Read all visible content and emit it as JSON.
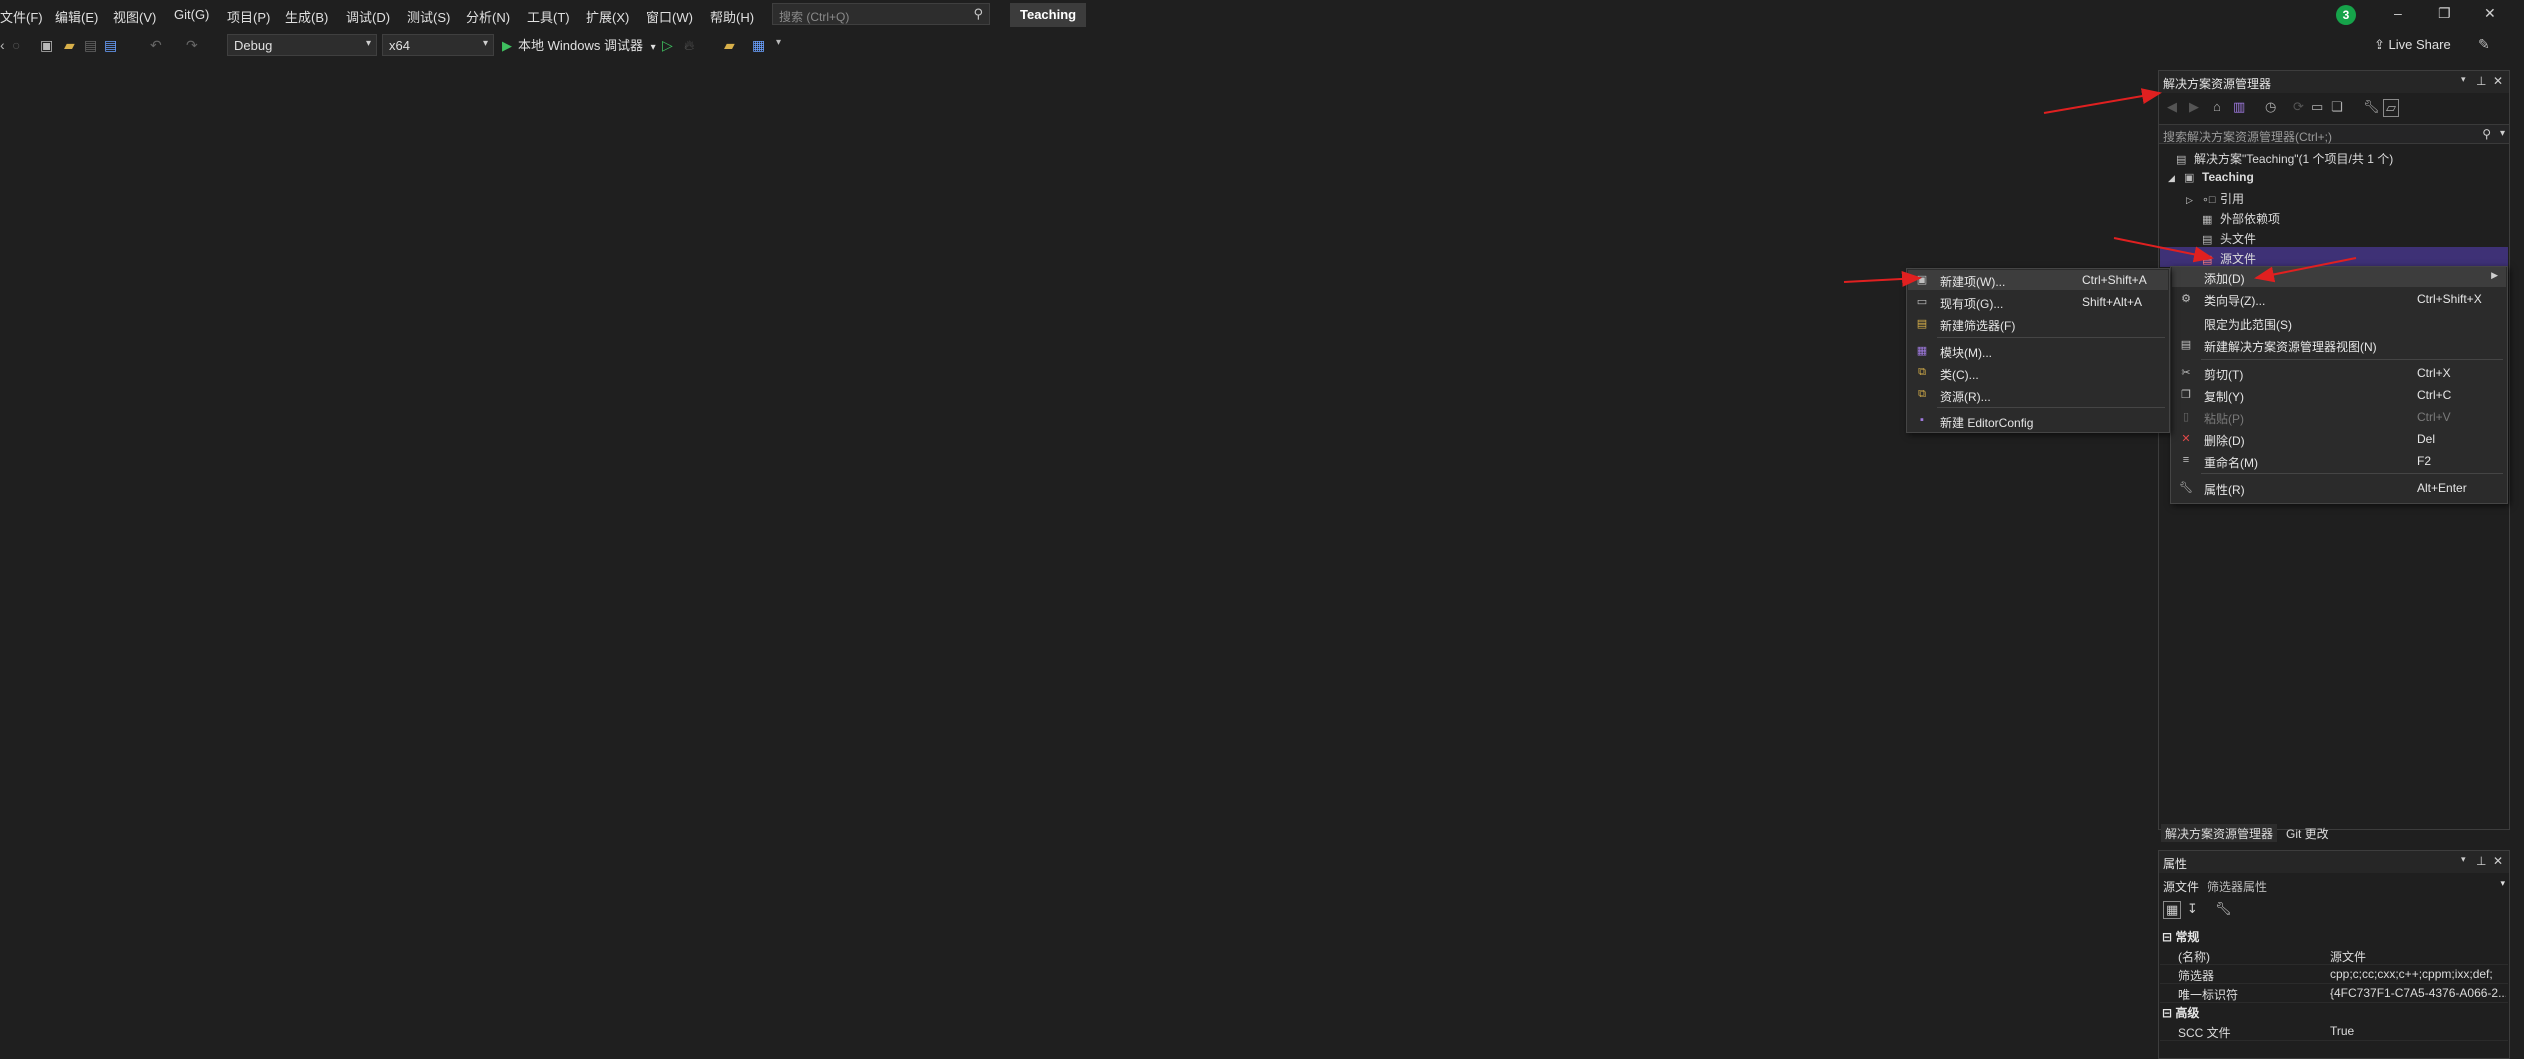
{
  "menu": {
    "items": [
      "文件(F)",
      "编辑(E)",
      "视图(V)",
      "Git(G)",
      "项目(P)",
      "生成(B)",
      "调试(D)",
      "测试(S)",
      "分析(N)",
      "工具(T)",
      "扩展(X)",
      "窗口(W)",
      "帮助(H)"
    ],
    "search_placeholder": "搜索 (Ctrl+Q)",
    "solution_name": "Teaching",
    "notification_count": "3"
  },
  "toolbar": {
    "configuration": "Debug",
    "platform": "x64",
    "run_label": "本地 Windows 调试器",
    "live_share": "Live Share"
  },
  "solution_explorer": {
    "title": "解决方案资源管理器",
    "search_placeholder": "搜索解决方案资源管理器(Ctrl+;)",
    "solution_row": "解决方案\"Teaching\"(1 个项目/共 1 个)",
    "project": "Teaching",
    "nodes": [
      "引用",
      "外部依赖项",
      "头文件",
      "源文件"
    ],
    "bottom_tabs": [
      "解决方案资源管理器",
      "Git 更改"
    ]
  },
  "context_menu": {
    "items": [
      {
        "label": "添加(D)",
        "shortcut": "",
        "submenu": true
      },
      {
        "label": "类向导(Z)...",
        "shortcut": "Ctrl+Shift+X"
      },
      {
        "label": "限定为此范围(S)",
        "shortcut": ""
      },
      {
        "label": "新建解决方案资源管理器视图(N)",
        "shortcut": ""
      },
      {
        "label": "剪切(T)",
        "shortcut": "Ctrl+X"
      },
      {
        "label": "复制(Y)",
        "shortcut": "Ctrl+C"
      },
      {
        "label": "粘贴(P)",
        "shortcut": "Ctrl+V",
        "disabled": true
      },
      {
        "label": "删除(D)",
        "shortcut": "Del"
      },
      {
        "label": "重命名(M)",
        "shortcut": "F2"
      },
      {
        "label": "属性(R)",
        "shortcut": "Alt+Enter"
      }
    ]
  },
  "add_submenu": {
    "items": [
      {
        "label": "新建项(W)...",
        "shortcut": "Ctrl+Shift+A"
      },
      {
        "label": "现有项(G)...",
        "shortcut": "Shift+Alt+A"
      },
      {
        "label": "新建筛选器(F)",
        "shortcut": ""
      },
      {
        "label": "模块(M)...",
        "shortcut": ""
      },
      {
        "label": "类(C)...",
        "shortcut": ""
      },
      {
        "label": "资源(R)...",
        "shortcut": ""
      },
      {
        "label": "新建 EditorConfig",
        "shortcut": ""
      }
    ]
  },
  "properties": {
    "title": "属性",
    "object_name": "源文件",
    "object_type": "筛选器属性",
    "categories": [
      "常规",
      "高级"
    ],
    "rows": [
      {
        "key": "(名称)",
        "value": "源文件"
      },
      {
        "key": "筛选器",
        "value": "cpp;c;cc;cxx;c++;cppm;ixx;def;"
      },
      {
        "key": "唯一标识符",
        "value": "{4FC737F1-C7A5-4376-A066-2..."
      },
      {
        "key": "SCC 文件",
        "value": "True"
      }
    ]
  },
  "colors": {
    "background": "#1f1f1f",
    "selection": "#3e3176",
    "annotation_arrow": "#e02020",
    "notification": "#16a34a"
  }
}
